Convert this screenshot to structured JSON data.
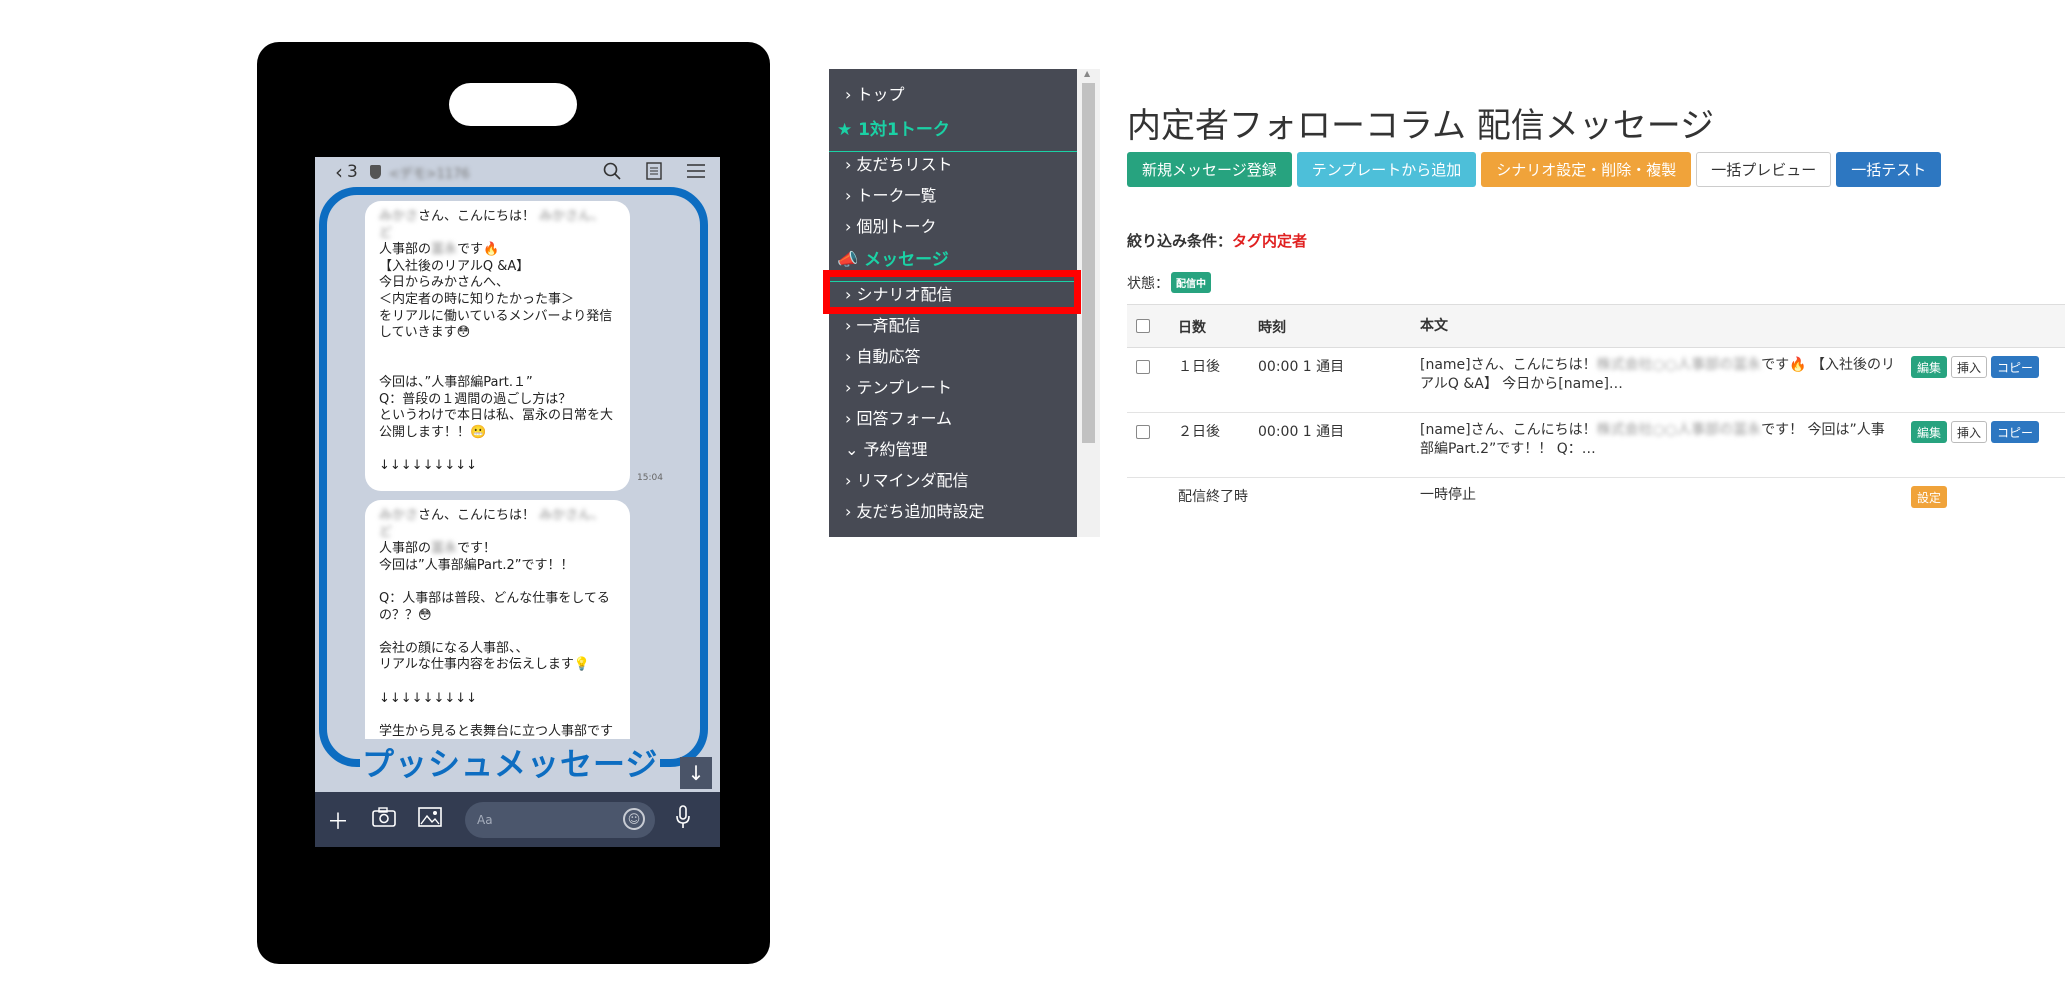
{
  "phone": {
    "header": {
      "back_count": "3",
      "name": "<デモ>1176"
    },
    "bubble1": {
      "greeting_suffix": "さん、こんにちは！",
      "line2_prefix": "人事部の",
      "line2_suffix": "です🔥",
      "body": "\n【入社後のリアルQ &A】\n今日からみかさんへ、\n＜内定者の時に知りたかった事＞\nをリアルに働いているメンバーより発信\nしていきます😳\n\n\n今回は、”人事部編Part.１”\nQ：普段の１週間の過ごし方は？\nというわけで本日は私、冨永の日常を大\n公開します！！😬\n\n↓↓↓↓↓↓↓↓↓",
      "time": "15:04"
    },
    "bubble2": {
      "greeting_suffix": "さん、こんにちは！",
      "line2_prefix": "人事部の",
      "line2_suffix": "です！",
      "body": "\n今回は”人事部編Part.2”です！！\n\nQ：人事部は普段、どんな仕事をしてる\nの？？😳\n\n会社の顔になる人事部、、\nリアルな仕事内容をお伝えします💡\n\n↓↓↓↓↓↓↓↓↓\n\n学生から見ると表舞台に立つ人事部です"
    },
    "push_label": "プッシュメッセージ",
    "input_placeholder": "Aa"
  },
  "sidebar": {
    "items": [
      {
        "label": "› トップ"
      },
      {
        "label": "★ 1対1トーク"
      },
      {
        "label": "› 友だちリスト"
      },
      {
        "label": "› トーク一覧"
      },
      {
        "label": "› 個別トーク"
      },
      {
        "label": "📣 メッセージ"
      },
      {
        "label": "› シナリオ配信"
      },
      {
        "label": "› 一斉配信"
      },
      {
        "label": "› 自動応答"
      },
      {
        "label": "› テンプレート"
      },
      {
        "label": "› 回答フォーム"
      },
      {
        "label": "⌄ 予約管理"
      },
      {
        "label": "› リマインダ配信"
      },
      {
        "label": "› 友だち追加時設定"
      }
    ]
  },
  "main": {
    "title": "内定者フォローコラム 配信メッセージ",
    "buttons": {
      "new": "新規メッセージ登録",
      "template": "テンプレートから追加",
      "scenario": "シナリオ設定・削除・複製",
      "preview": "一括プレビュー",
      "test": "一括テスト"
    },
    "filter_label": "絞り込み条件：",
    "filter_value": "タグ内定者",
    "status_label": "状態：",
    "status_badge": "配信中",
    "table": {
      "headers": {
        "day": "日数",
        "time": "時刻",
        "body": "本文"
      },
      "rows": [
        {
          "day": "１日後",
          "time": "00:00 1 通目",
          "body_a": "[name]さん、こんにちは！",
          "body_b": "です🔥 【入社後のリアルQ &A】 今日から[name]…"
        },
        {
          "day": "２日後",
          "time": "00:00 1 通目",
          "body_a": "[name]さん、こんにちは！",
          "body_b": "です！ 今回は”人事部編Part.2”です！！ Q：…"
        }
      ],
      "ops": {
        "edit": "編集",
        "insert": "挿入",
        "copy": "コピー"
      },
      "footer": {
        "label": "配信終了時",
        "value": "一時停止",
        "setting": "設定"
      }
    }
  }
}
